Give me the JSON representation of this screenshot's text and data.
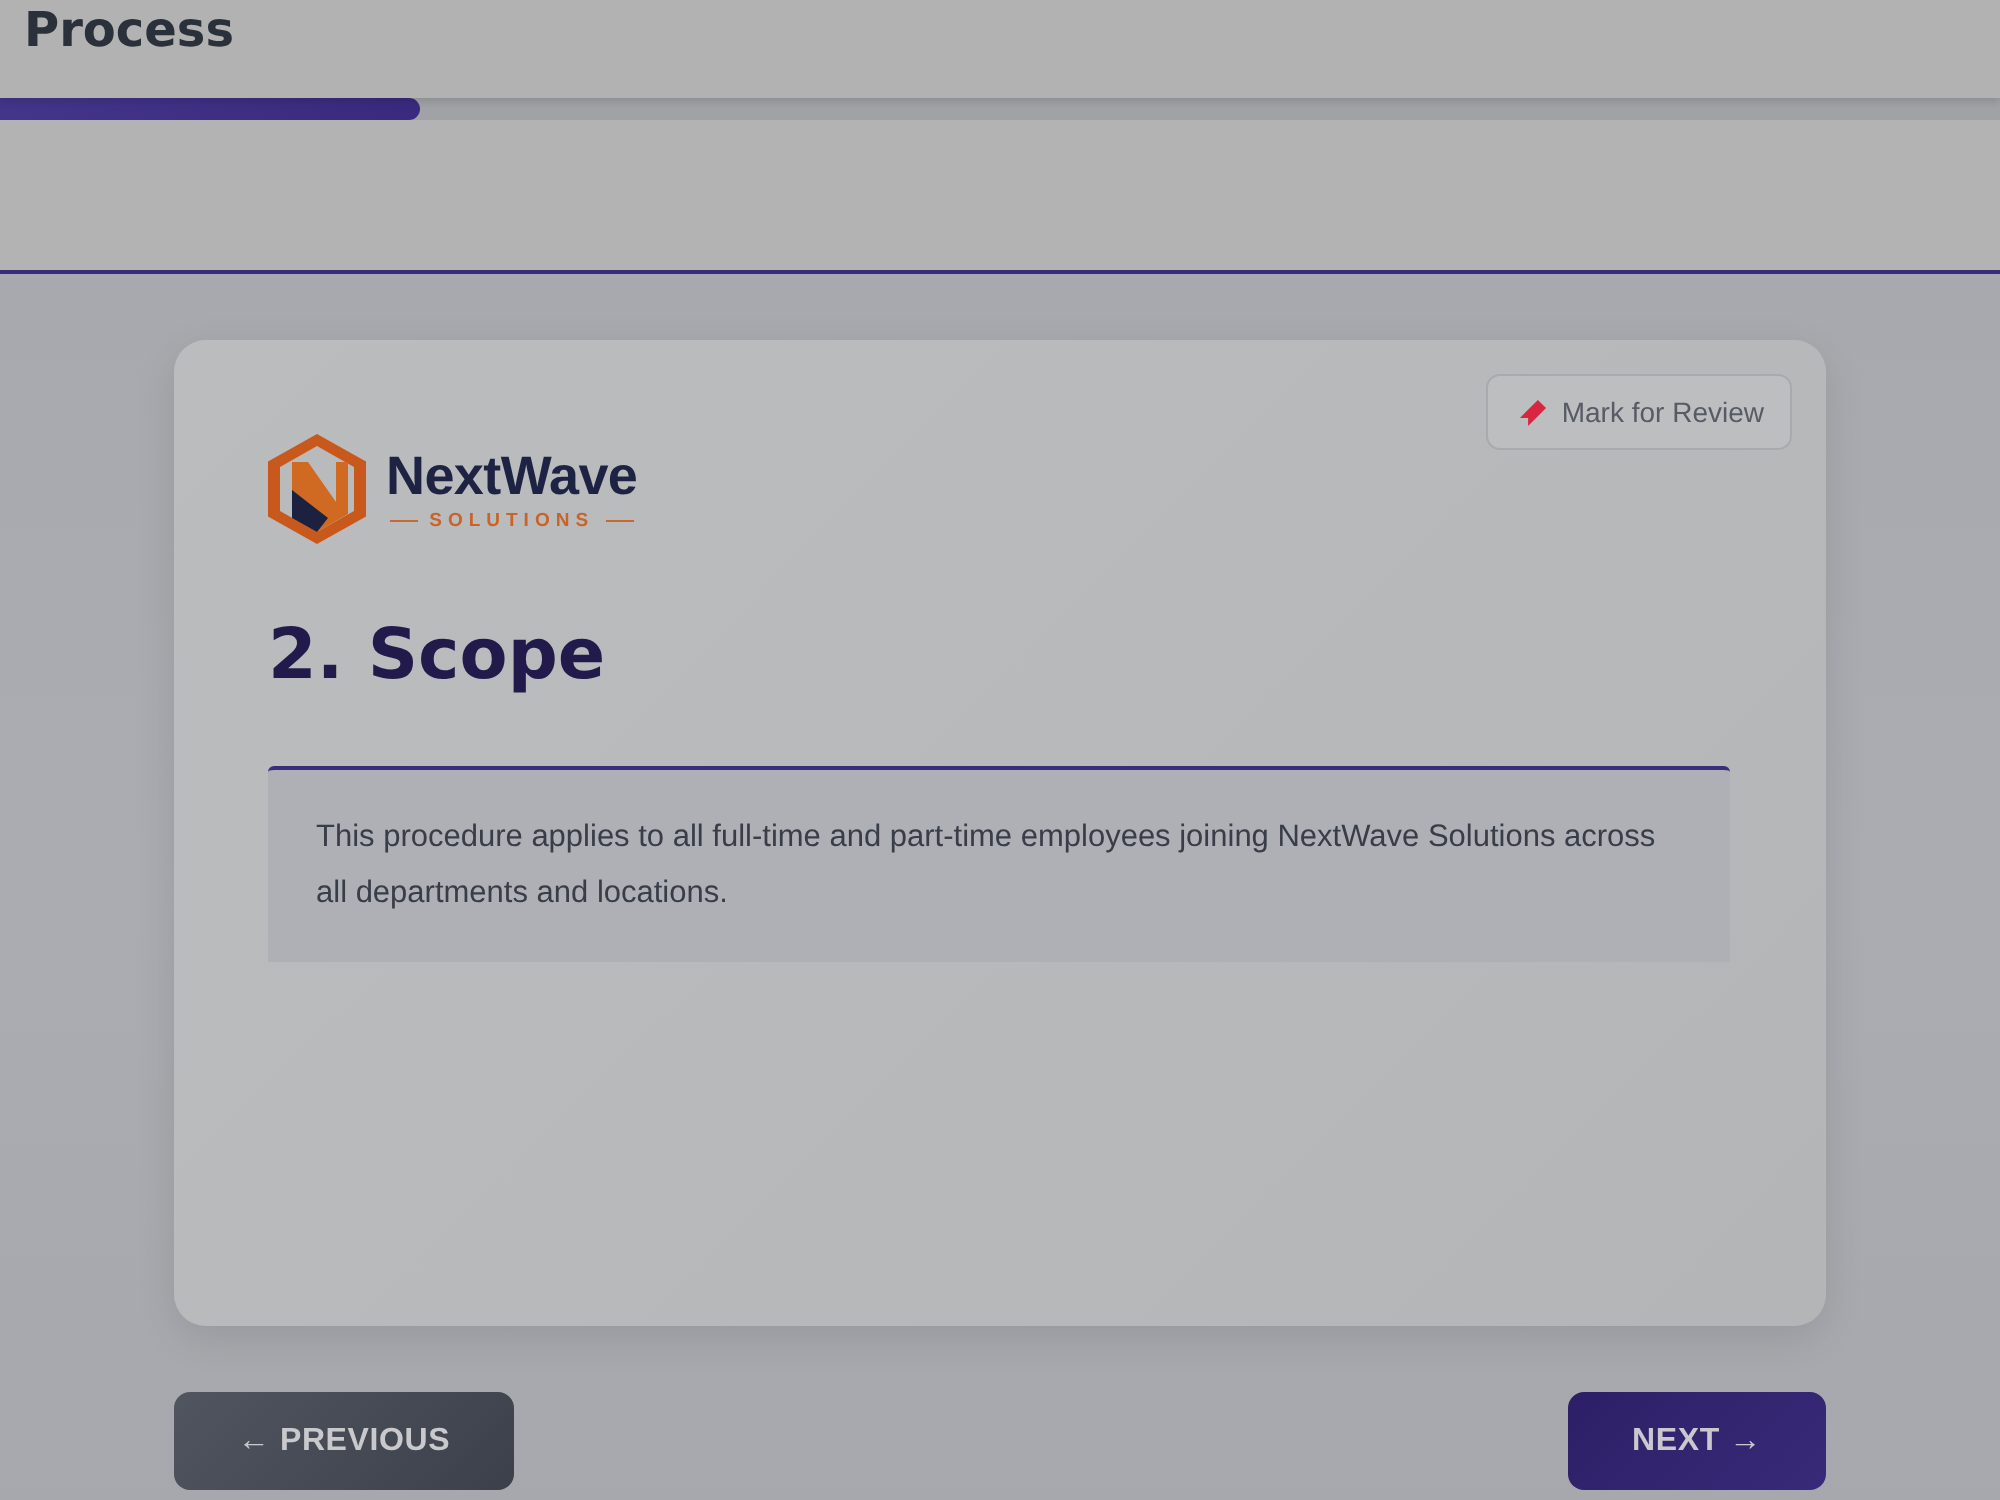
{
  "header": {
    "title": "Process",
    "progress": {
      "level": 0.21
    }
  },
  "card": {
    "review_button": {
      "label": "Mark for Review"
    },
    "logo": {
      "name": "NextWave",
      "tagline": "SOLUTIONS"
    },
    "heading": "2. Scope",
    "body": "This procedure applies to all full-time and part-time employees joining NextWave Solutions across all departments and locations."
  },
  "nav": {
    "previous": "← PREVIOUS",
    "next": "NEXT →"
  }
}
